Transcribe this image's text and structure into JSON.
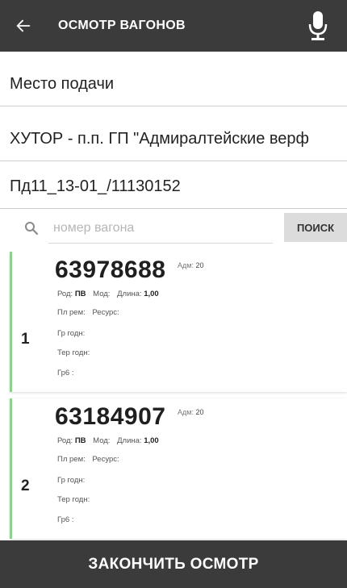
{
  "header": {
    "title": "ОСМОТР ВАГОНОВ",
    "back_icon": "arrow-left-icon",
    "mic_icon": "microphone-icon"
  },
  "fields": {
    "place_label": "Место подачи",
    "station": "ХУТОР - п.п. ГП \"Адмиралтейские верф",
    "document": "Пд11_13-01_/11130152"
  },
  "search": {
    "placeholder": "номер вагона",
    "button_label": "ПОИСК",
    "icon": "search-icon"
  },
  "wagons": [
    {
      "index": "1",
      "number": "63978688",
      "adm_label": "Адм:",
      "adm_value": "20",
      "rod_label": "Род:",
      "rod_value": "ПВ",
      "mod_label": "Мод:",
      "length_label": "Длина:",
      "length_value": "1,00",
      "plrem_label": "Пл рем:",
      "resource_label": "Ресурс:",
      "gr_label": "Гр годн:",
      "ter_label": "Тер годн:",
      "grb_label": "Гр6 :"
    },
    {
      "index": "2",
      "number": "63184907",
      "adm_label": "Адм:",
      "adm_value": "20",
      "rod_label": "Род:",
      "rod_value": "ПВ",
      "mod_label": "Мод:",
      "length_label": "Длина:",
      "length_value": "1,00",
      "plrem_label": "Пл рем:",
      "resource_label": "Ресурс:",
      "gr_label": "Гр годн:",
      "ter_label": "Тер годн:",
      "grb_label": "Гр6 :"
    }
  ],
  "footer": {
    "finish_label": "ЗАКОНЧИТЬ ОСМОТР"
  },
  "colors": {
    "bar": "#3b3b3b",
    "card_accent": "#8fd08f",
    "search_button": "#dcdcdc"
  }
}
